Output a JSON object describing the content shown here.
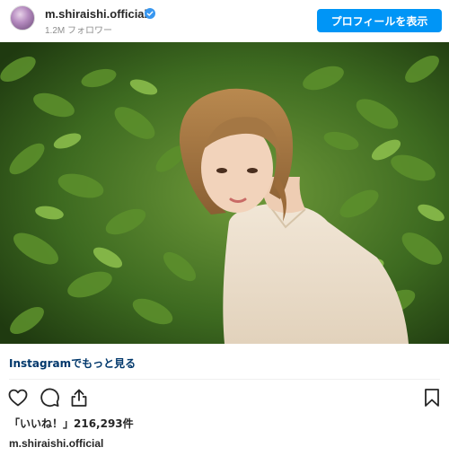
{
  "header": {
    "username": "m.shiraishi.official",
    "followers": "1.2M フォロワー",
    "profile_button": "プロフィールを表示",
    "verified": true
  },
  "post": {
    "photo_alt": "",
    "more_link": "Instagramでもっと見る",
    "likes": "「いいね！」216,293件",
    "caption_username": "m.shiraishi.official"
  },
  "actions": {
    "icons": [
      "heart-icon",
      "comment-icon",
      "share-icon",
      "bookmark-icon"
    ]
  },
  "colors": {
    "accent": "#0095f6",
    "link": "#00376b",
    "muted": "#8e8e8e",
    "text": "#262626"
  }
}
